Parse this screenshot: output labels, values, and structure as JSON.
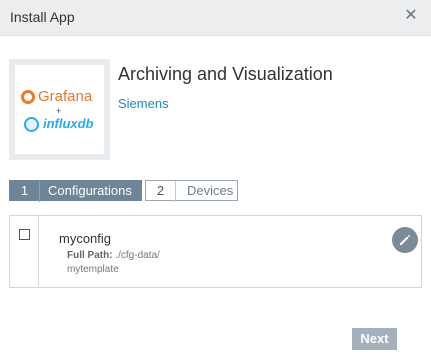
{
  "dialog": {
    "title": "Install App",
    "close_icon": "close-icon"
  },
  "app": {
    "name": "Archiving and Visualization",
    "vendor": "Siemens",
    "logo": {
      "grafana_text": "Grafana",
      "plus": "+",
      "influx_text": "influxdb"
    }
  },
  "steps": [
    {
      "number": "1",
      "label": "Configurations",
      "active": true
    },
    {
      "number": "2",
      "label": "Devices",
      "active": false
    }
  ],
  "config": {
    "name": "myconfig",
    "path_label": "Full Path:",
    "path_value": "./cfg-data/",
    "path_value2": "mytemplate",
    "checked": false
  },
  "footer": {
    "next_label": "Next"
  },
  "colors": {
    "accent": "#6d8597",
    "link": "#1b8ac0",
    "next_disabled": "#a3b1bc"
  }
}
